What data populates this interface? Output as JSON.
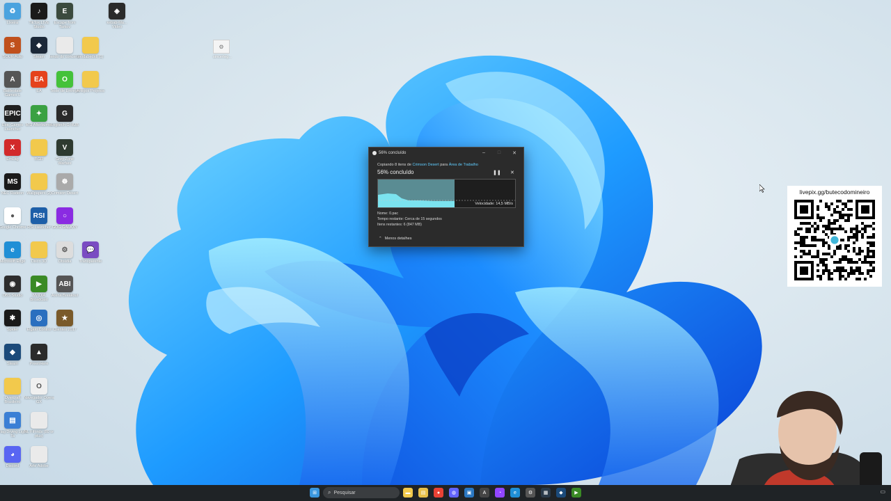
{
  "desktop": {
    "icons": [
      {
        "label": "Lixeira",
        "color": "#4aa3df",
        "glyph": "♻"
      },
      {
        "label": "TikTok LIVE Studio",
        "color": "#1a1a1a",
        "glyph": "♪"
      },
      {
        "label": "Escape from Tarkov",
        "color": "#3b4a3e",
        "glyph": "E"
      },
      {
        "label": "SOUR Auto",
        "color": "#c0501c",
        "glyph": "S"
      },
      {
        "label": "Steam",
        "color": "#1b2838",
        "glyph": "◆"
      },
      {
        "label": "lendo do concerto",
        "color": "#eaeaea",
        "glyph": ""
      },
      {
        "label": "modabedrill (1)",
        "color": "#f2c94c",
        "glyph": ""
      },
      {
        "label": "Battlestate Games L",
        "color": "#555555",
        "glyph": "A"
      },
      {
        "label": "EA",
        "color": "#e5421c",
        "glyph": "EA"
      },
      {
        "label": "Teste de Entrega",
        "color": "#44c23a",
        "glyph": "O"
      },
      {
        "label": "Antigos Projetos",
        "color": "#f2c94c",
        "glyph": ""
      },
      {
        "label": "Epic Games Launcher",
        "color": "#202020",
        "glyph": "EPIC"
      },
      {
        "label": "MSI Afterburner",
        "color": "#3aa142",
        "glyph": "✦"
      },
      {
        "label": "Logitech G HUB",
        "color": "#2a2a2a",
        "glyph": "G"
      },
      {
        "label": "EmLag",
        "color": "#d22a2a",
        "glyph": "X"
      },
      {
        "label": "BGR",
        "color": "#f2c94c",
        "glyph": ""
      },
      {
        "label": "Grey Zone Warfare",
        "color": "#2e3a30",
        "glyph": "V"
      },
      {
        "label": "NEC Radeon",
        "color": "#1a1a1a",
        "glyph": "MS"
      },
      {
        "label": "Wallpapers (2)",
        "color": "#f2c94c",
        "glyph": ""
      },
      {
        "label": "Crimson Desert",
        "color": "#aaaaaa",
        "glyph": "☸"
      },
      {
        "label": "Google Chrome",
        "color": "#ffffff",
        "glyph": "●"
      },
      {
        "label": "RSI Launcher",
        "color": "#1d5fa8",
        "glyph": "RSI"
      },
      {
        "label": "GOG GALAXY",
        "color": "#8a2be2",
        "glyph": "○"
      },
      {
        "label": "Microsoft Edge",
        "color": "#1f8fd6",
        "glyph": "e"
      },
      {
        "label": "Disco 3D",
        "color": "#f2c94c",
        "glyph": ""
      },
      {
        "label": "Obsidia",
        "color": "#dddddd",
        "glyph": "⚙"
      },
      {
        "label": "Transparente",
        "color": "#7a4cc2",
        "glyph": "💬"
      },
      {
        "label": "OBS Studio",
        "color": "#2d2d2d",
        "glyph": "◉"
      },
      {
        "label": "NVIDIA Broadcast",
        "color": "#3a8a25",
        "glyph": "▶"
      },
      {
        "label": "Arena Breakout",
        "color": "#555555",
        "glyph": "ABI"
      },
      {
        "label": "Spider",
        "color": "#1a1a1a",
        "glyph": "✱"
      },
      {
        "label": "Elgato Control",
        "color": "#2a6fbf",
        "glyph": "◎"
      },
      {
        "label": "Clientes 2017",
        "color": "#7a5a2a",
        "glyph": "★"
      },
      {
        "label": "Steam",
        "color": "#1b4a7a",
        "glyph": "◆"
      },
      {
        "label": "PreenHere",
        "color": "#2b2b2b",
        "glyph": "▲"
      },
      {
        "label": "Overcraft Brasileiro",
        "color": "#f2c94c",
        "glyph": ""
      },
      {
        "label": "Navegador Opera GX",
        "color": "#f0f0f0",
        "glyph": "O"
      },
      {
        "label": "Flag Drying Light Ta",
        "color": "#3a7fd5",
        "glyph": "▤"
      },
      {
        "label": "NL FiFinds (80 or plus)",
        "color": "#eaeaea",
        "glyph": ""
      },
      {
        "label": "Discord",
        "color": "#5865f2",
        "glyph": "◕"
      },
      {
        "label": "Arte Adobe",
        "color": "#eaeaea",
        "glyph": ""
      }
    ],
    "top_right_icon": {
      "label": "kebab-Ma... Vídeo",
      "color": "#2b2b2b",
      "glyph": "◈"
    },
    "stray_file": {
      "label": "sincerteg..."
    }
  },
  "copy_dialog": {
    "title": "56% concluído",
    "source_prefix": "Copiando 8 itens de ",
    "source_name": "Crimson Desert",
    "source_mid": " para ",
    "dest_name": "Área de Trabalho",
    "percent_label": "56% concluído",
    "progress": 0.56,
    "speed": "Velocidade: 14,5 MB/s",
    "name_line": "Nome: 0.pac",
    "time_line": "Tempo restante: Cerca de 15 segundos",
    "items_line": "Itens restantes: 6 (847 MB)",
    "less_details": "Menos detalhes",
    "accent": "#60cdff"
  },
  "qr_panel": {
    "url": "livepix.gg/butecodomineiro"
  },
  "taskbar": {
    "search_placeholder": "Pesquisar",
    "icons": [
      {
        "name": "start-icon",
        "color": "#3a96dd",
        "glyph": "⊞"
      },
      {
        "name": "file-explorer-icon",
        "color": "#f2c94c",
        "glyph": "▬"
      },
      {
        "name": "folder-icon",
        "color": "#e8c04a",
        "glyph": "▤"
      },
      {
        "name": "chrome-icon",
        "color": "#e94235",
        "glyph": "●"
      },
      {
        "name": "mastodon-icon",
        "color": "#6364ff",
        "glyph": "◍"
      },
      {
        "name": "app-icon",
        "color": "#2b78c2",
        "glyph": "▣"
      },
      {
        "name": "calligraphy-icon",
        "color": "#444444",
        "glyph": "A"
      },
      {
        "name": "twitch-icon",
        "color": "#9146ff",
        "glyph": "◔"
      },
      {
        "name": "edge-icon",
        "color": "#1f8fd6",
        "glyph": "e"
      },
      {
        "name": "settings-icon",
        "color": "#555555",
        "glyph": "⚙"
      },
      {
        "name": "taskbar-app-icon",
        "color": "#2a3a4a",
        "glyph": "▦"
      },
      {
        "name": "steam-icon",
        "color": "#1b4a7a",
        "glyph": "◆"
      },
      {
        "name": "nvidia-icon",
        "color": "#3a8a25",
        "glyph": "▶"
      }
    ]
  }
}
